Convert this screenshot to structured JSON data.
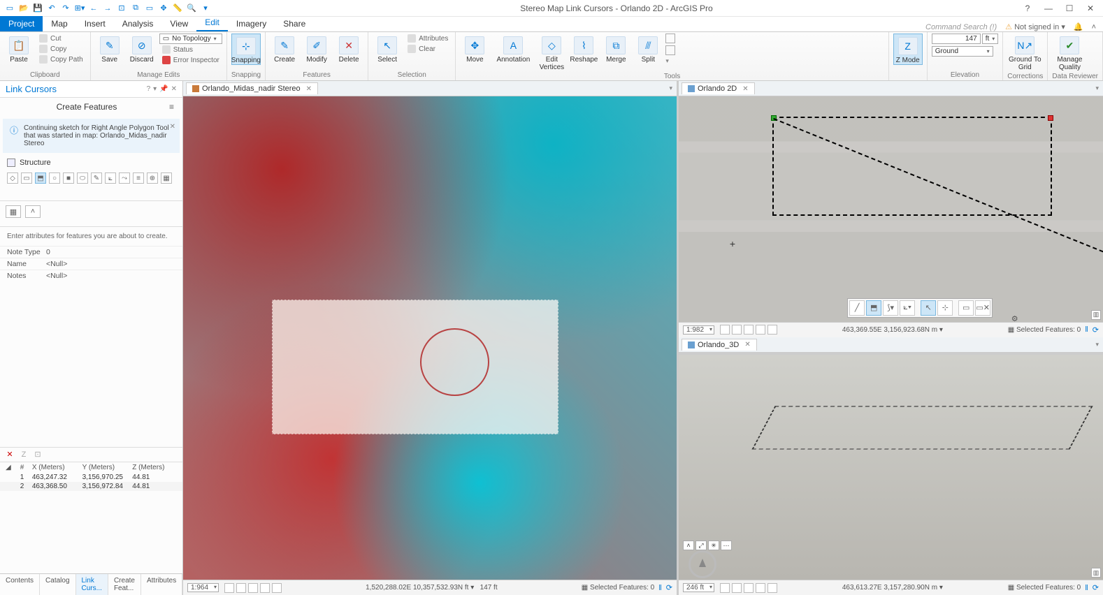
{
  "app_title": "Stereo Map Link Cursors - Orlando 2D - ArcGIS Pro",
  "signin": "Not signed in",
  "command_search": "Command Search (!)",
  "tabs": {
    "project": "Project",
    "map": "Map",
    "insert": "Insert",
    "analysis": "Analysis",
    "view": "View",
    "edit": "Edit",
    "imagery": "Imagery",
    "share": "Share"
  },
  "ribbon": {
    "clipboard": {
      "paste": "Paste",
      "cut": "Cut",
      "copy": "Copy",
      "copypath": "Copy Path",
      "label": "Clipboard"
    },
    "manage": {
      "save": "Save",
      "discard": "Discard",
      "topo": "No Topology",
      "status": "Status",
      "inspector": "Error Inspector",
      "label": "Manage Edits"
    },
    "snapping": {
      "btn": "Snapping",
      "label": "Snapping"
    },
    "features": {
      "create": "Create",
      "modify": "Modify",
      "delete": "Delete",
      "label": "Features"
    },
    "selection": {
      "select": "Select",
      "attrs": "Attributes",
      "clear": "Clear",
      "label": "Selection"
    },
    "tools": {
      "move": "Move",
      "annotation": "Annotation",
      "editvert": "Edit\nVertices",
      "reshape": "Reshape",
      "merge": "Merge",
      "split": "Split",
      "label": "Tools"
    },
    "zmode": {
      "btn": "Z\nMode"
    },
    "elevation": {
      "surface": "Ground",
      "value": "147",
      "unit": "ft",
      "label": "Elevation"
    },
    "corrections": {
      "g2g": "Ground\nTo Grid",
      "label": "Corrections"
    },
    "reviewer": {
      "mq": "Manage\nQuality",
      "label": "Data Reviewer"
    }
  },
  "left": {
    "title": "Link Cursors",
    "cf": "Create Features",
    "info": "Continuing sketch for Right Angle Polygon Tool that was started in map: Orlando_Midas_nadir Stereo",
    "structure": "Structure",
    "attr_hint": "Enter attributes for features you are about to create.",
    "rows": {
      "notetype_k": "Note Type",
      "notetype_v": "0",
      "name_k": "Name",
      "name_v": "<Null>",
      "notes_k": "Notes",
      "notes_v": "<Null>"
    },
    "vheaders": {
      "x": "X (Meters)",
      "y": "Y (Meters)",
      "z": "Z (Meters)"
    },
    "v1": {
      "n": "1",
      "x": "463,247.32",
      "y": "3,156,970.25",
      "z": "44.81"
    },
    "v2": {
      "n": "2",
      "x": "463,368.50",
      "y": "3,156,972.84",
      "z": "44.81"
    },
    "tabs": {
      "contents": "Contents",
      "catalog": "Catalog",
      "link": "Link Curs...",
      "createf": "Create Feat...",
      "attrs": "Attributes"
    }
  },
  "viewtabs": {
    "stereo": "Orlando_Midas_nadir Stereo",
    "v2d": "Orlando 2D",
    "v3d": "Orlando_3D"
  },
  "status_stereo": {
    "scale": "1:964",
    "coords": "1,520,288.02E 10,357,532.93N ft",
    "elev": "147 ft",
    "sel": "Selected Features: 0"
  },
  "status_2d": {
    "scale": "1:982",
    "coords": "463,369.55E 3,156,923.68N m",
    "sel": "Selected Features: 0"
  },
  "status_3d": {
    "scale": "246 ft",
    "coords": "463,613.27E 3,157,280.90N m",
    "sel": "Selected Features: 0"
  }
}
